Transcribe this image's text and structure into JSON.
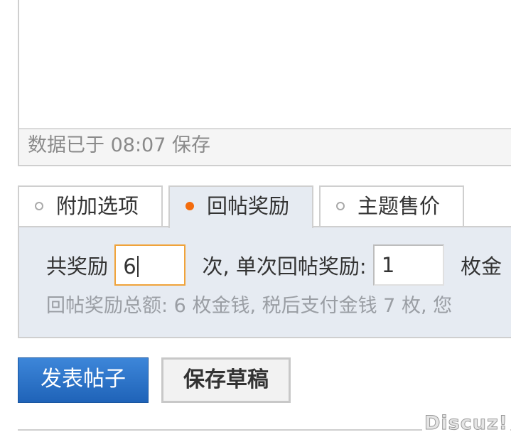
{
  "editor": {
    "status_text": "数据已于 08:07 保存"
  },
  "tabs": [
    {
      "label": "附加选项",
      "active": false
    },
    {
      "label": "回帖奖励",
      "active": true
    },
    {
      "label": "主题售价",
      "active": false
    }
  ],
  "reward": {
    "label_total": "共奖励",
    "times_value": "6",
    "label_per": "次, 单次回帖奖励:",
    "per_value": "1",
    "unit_trail": "枚金",
    "summary": "回帖奖励总额: 6 枚金钱, 税后支付金钱 7 枚, 您"
  },
  "buttons": {
    "post": "发表帖子",
    "draft": "保存草稿"
  },
  "footer": {
    "logo_text": "Discuz!"
  },
  "colors": {
    "accent": "#2f7ad0",
    "active_dot": "#f36c0e",
    "panel_bg": "#e6ebf2",
    "focus_border": "#f0a33a"
  }
}
